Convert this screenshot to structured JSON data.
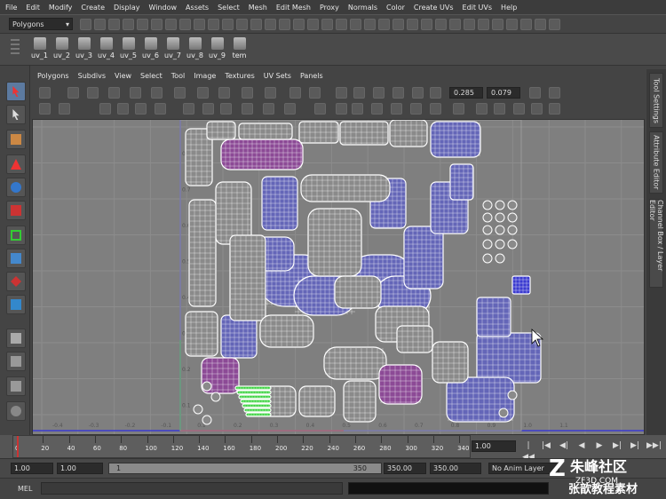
{
  "menubar": {
    "items": [
      "File",
      "Edit",
      "Modify",
      "Create",
      "Display",
      "Window",
      "Assets",
      "Select",
      "Mesh",
      "Edit Mesh",
      "Proxy",
      "Normals",
      "Color",
      "Create UVs",
      "Edit UVs",
      "Help"
    ]
  },
  "status": {
    "mode": "Polygons"
  },
  "shelf": {
    "items": [
      "uv_1",
      "uv_2",
      "uv_3",
      "uv_4",
      "uv_5",
      "uv_6",
      "uv_7",
      "uv_8",
      "uv_9",
      "tem"
    ]
  },
  "uv_panel": {
    "menu": [
      "Polygons",
      "Subdivs",
      "View",
      "Select",
      "Tool",
      "Image",
      "Textures",
      "UV Sets",
      "Panels"
    ],
    "field_u": "0.285",
    "field_v": "0.079",
    "grid_labels": {
      "left_axis": [
        "0.8",
        "0.7",
        "0.6",
        "0.5",
        "0.4",
        "0.3",
        "0.2",
        "0.1"
      ],
      "bottom_axis": [
        "-0.4",
        "-0.3",
        "-0.2",
        "-0.1",
        "0.1",
        "0.2",
        "0.3",
        "0.4",
        "0.5",
        "0.6",
        "0.7",
        "0.8",
        "0.9",
        "1.0",
        "1.1"
      ]
    }
  },
  "side_tabs": [
    "Tool Settings",
    "Attribute Editor",
    "Channel Box / Layer Editor"
  ],
  "timeline": {
    "ticks": [
      "0",
      "20",
      "40",
      "60",
      "80",
      "100",
      "120",
      "140",
      "160",
      "180",
      "200",
      "220",
      "240",
      "260",
      "280",
      "300",
      "320",
      "340"
    ],
    "current_frame": "1.00",
    "buttons": [
      "|◀◀",
      "|◀",
      "◀|",
      "◀",
      "▶",
      "▶|",
      "▶|",
      "▶▶|"
    ]
  },
  "range": {
    "start_time": "1.00",
    "playback_start": "1.00",
    "slider_start": "1",
    "slider_end": "350",
    "playback_end": "350.00",
    "end_time": "350.00",
    "anim_layer": "No Anim Layer"
  },
  "cmdline": {
    "label": "MEL"
  },
  "watermark": {
    "line1": "朱峰社区",
    "line2": "ZF3D.COM",
    "line3": "张歆教程素材"
  },
  "colors": {
    "uv_blue": "#6466b8",
    "uv_purple": "#8c4a96",
    "uv_green": "#35d13a",
    "grid_bg": "#7f7f7f"
  }
}
